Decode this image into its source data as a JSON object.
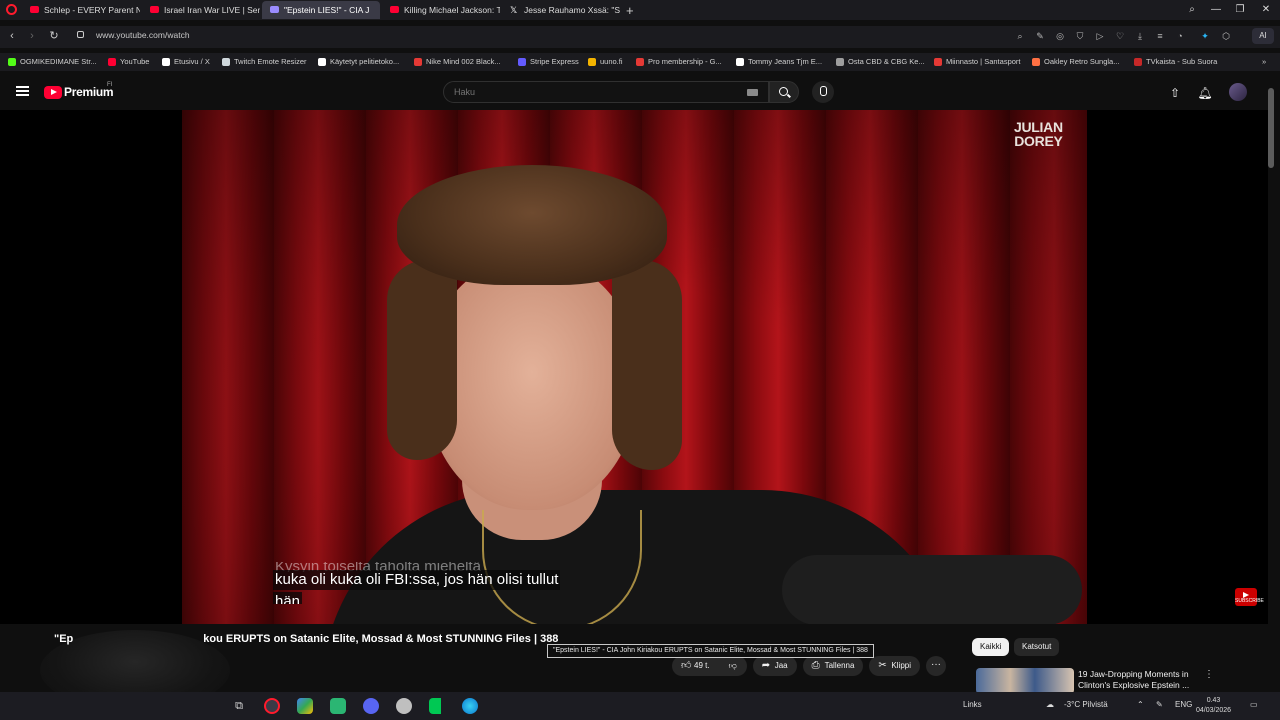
{
  "browser": {
    "tabs": [
      {
        "title": "Schlep - EVERY Parent Ne",
        "icon": "youtube-icon"
      },
      {
        "title": "Israel Iran War LIVE | Seric",
        "icon": "youtube-icon"
      },
      {
        "title": "\"Epstein LIES!\" - CIA J",
        "icon": "speaker-icon",
        "active": true
      },
      {
        "title": "Killing Michael Jackson: Th",
        "icon": "youtube-icon"
      },
      {
        "title": "Jesse Rauhamo Xssä: \"Su",
        "icon": "x-icon"
      }
    ],
    "new_tab": "+",
    "url": "www.youtube.com/watch",
    "ai_label": "AI"
  },
  "bookmarks": [
    {
      "label": "OGMIKEDIMANE Str...",
      "color": "#53fc18"
    },
    {
      "label": "YouTube",
      "color": "#ff0033"
    },
    {
      "label": "Etusivu / X",
      "color": "#ffffff"
    },
    {
      "label": "Twitch Emote Resizer",
      "color": "#cfd8dc"
    },
    {
      "label": "Käytetyt pelitietoko...",
      "color": "#ffffff"
    },
    {
      "label": "Nike Mind 002 Black...",
      "color": "#e53935"
    },
    {
      "label": "Stripe Express",
      "color": "#635bff"
    },
    {
      "label": "uuno.fi",
      "color": "#f4b400"
    },
    {
      "label": "Pro membership - G...",
      "color": "#e53935"
    },
    {
      "label": "Tommy Jeans Tjm E...",
      "color": "#ffffff"
    },
    {
      "label": "Osta CBD & CBG Ke...",
      "color": "#9e9e9e"
    },
    {
      "label": "Miinnasto | Santasport",
      "color": "#e53935"
    },
    {
      "label": "Oakley Retro Sungla...",
      "color": "#ff7043"
    },
    {
      "label": "TVkaista - Sub Suora",
      "color": "#c62828"
    }
  ],
  "youtube": {
    "brand": "Premium",
    "region": "FI",
    "search_placeholder": "Haku"
  },
  "video": {
    "watermark_line1": "JULIAN",
    "watermark_line2": "DOREY",
    "subtitle_faded": "Kysyin toiselta taholta mieheltä",
    "subtitle_line1": "kuka oli kuka oli FBI:ssa, jos hän olisi tullut",
    "subtitle_line2": "hän",
    "subscribe_label": "SUBSCRIBE"
  },
  "below": {
    "title_left": "\"Ep",
    "title_right": "kou ERUPTS on Satanic Elite, Mossad & Most STUNNING Files | 388",
    "tooltip": "\"Epstein LIES!\" - CIA John Kiriakou ERUPTS on Satanic Elite, Mossad & Most STUNNING Files | 388",
    "like_count": "49 t.",
    "share_label": "Jaa",
    "save_label": "Tallenna",
    "clip_label": "Klippi",
    "more_label": "···"
  },
  "chips": [
    "Kaikki",
    "Katsotut"
  ],
  "recommendation": {
    "title": "19 Jaw-Dropping Moments in Clinton's Explosive Epstein ..."
  },
  "taskbar": {
    "links": "Links",
    "weather": "-3°C  Pilvistä",
    "lang": "ENG",
    "time": "0.43",
    "date": "04/03/2026"
  }
}
